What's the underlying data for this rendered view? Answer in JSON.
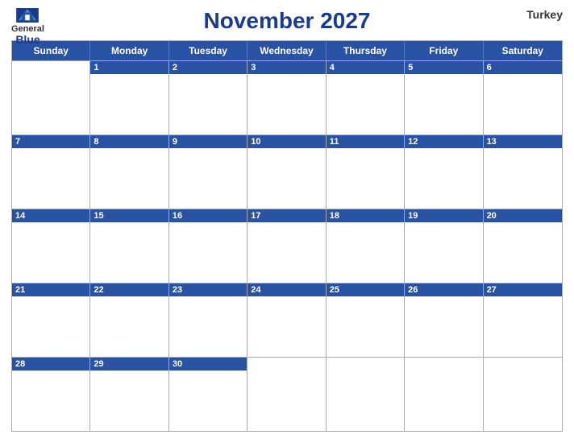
{
  "header": {
    "title": "November 2027",
    "country": "Turkey",
    "logo": {
      "general": "General",
      "blue": "Blue"
    }
  },
  "days_of_week": [
    "Sunday",
    "Monday",
    "Tuesday",
    "Wednesday",
    "Thursday",
    "Friday",
    "Saturday"
  ],
  "weeks": [
    [
      {
        "num": "",
        "empty": true
      },
      {
        "num": "1"
      },
      {
        "num": "2"
      },
      {
        "num": "3"
      },
      {
        "num": "4"
      },
      {
        "num": "5"
      },
      {
        "num": "6"
      }
    ],
    [
      {
        "num": "7"
      },
      {
        "num": "8"
      },
      {
        "num": "9"
      },
      {
        "num": "10"
      },
      {
        "num": "11"
      },
      {
        "num": "12"
      },
      {
        "num": "13"
      }
    ],
    [
      {
        "num": "14"
      },
      {
        "num": "15"
      },
      {
        "num": "16"
      },
      {
        "num": "17"
      },
      {
        "num": "18"
      },
      {
        "num": "19"
      },
      {
        "num": "20"
      }
    ],
    [
      {
        "num": "21"
      },
      {
        "num": "22"
      },
      {
        "num": "23"
      },
      {
        "num": "24"
      },
      {
        "num": "25"
      },
      {
        "num": "26"
      },
      {
        "num": "27"
      }
    ],
    [
      {
        "num": "28"
      },
      {
        "num": "29"
      },
      {
        "num": "30"
      },
      {
        "num": "",
        "empty": true
      },
      {
        "num": "",
        "empty": true
      },
      {
        "num": "",
        "empty": true
      },
      {
        "num": "",
        "empty": true
      }
    ]
  ],
  "colors": {
    "header_bg": "#2952a3",
    "header_text": "#ffffff",
    "title_color": "#1a3a8c"
  }
}
